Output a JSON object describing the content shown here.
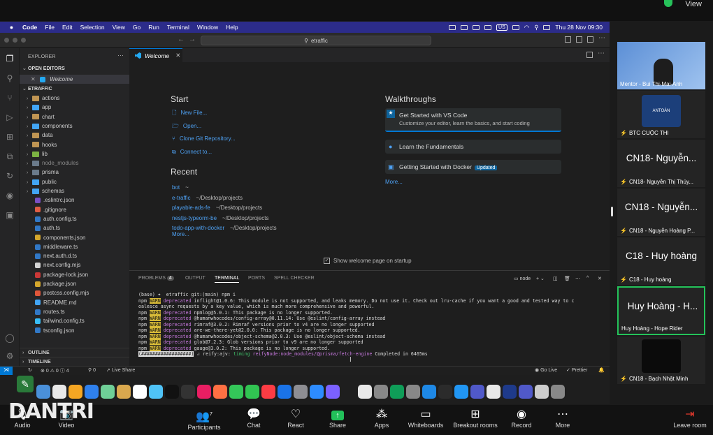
{
  "zoom_top": {
    "view_label": "View"
  },
  "mac_menu": {
    "apple": "",
    "items": [
      "Code",
      "File",
      "Edit",
      "Selection",
      "View",
      "Go",
      "Run",
      "Terminal",
      "Window",
      "Help"
    ],
    "input_source": "US",
    "datetime": "Thu 28 Nov 09:30"
  },
  "vscode": {
    "search_text": "etraffic",
    "explorer_title": "EXPLORER",
    "open_editors_title": "OPEN EDITORS",
    "open_editor_file": "Welcome",
    "project_title": "ETRAFFIC",
    "folders": [
      "actions",
      "app",
      "chart",
      "components",
      "data",
      "hooks",
      "lib",
      "node_modules",
      "prisma",
      "public",
      "schemas"
    ],
    "files": [
      ".eslintrc.json",
      ".gitignore",
      "auth.config.ts",
      "auth.ts",
      "components.json",
      "middleware.ts",
      "next.auth.d.ts",
      "next.config.mjs",
      "package-lock.json",
      "package.json",
      "postcss.config.mjs",
      "README.md",
      "routes.ts",
      "tailwind.config.ts",
      "tsconfig.json"
    ],
    "outline_label": "OUTLINE",
    "timeline_label": "TIMELINE",
    "tab_label": "Welcome",
    "welcome": {
      "start_title": "Start",
      "start_items": [
        "New File...",
        "Open...",
        "Clone Git Repository...",
        "Connect to..."
      ],
      "recent_title": "Recent",
      "recent": [
        {
          "name": "bot",
          "path": "~"
        },
        {
          "name": "e-traffic",
          "path": "~/Desktop/projects"
        },
        {
          "name": "playable-ads-fe",
          "path": "~/Desktop/projects"
        },
        {
          "name": "nestjs-typeorm-be",
          "path": "~/Desktop/projects"
        },
        {
          "name": "todo-app-with-docker",
          "path": "~/Desktop/projects"
        }
      ],
      "recent_more": "More...",
      "walkthroughs_title": "Walkthroughs",
      "walk_items": [
        {
          "title": "Get Started with VS Code",
          "desc": "Customize your editor, learn the basics, and start coding"
        },
        {
          "title": "Learn the Fundamentals"
        },
        {
          "title": "Getting Started with Docker",
          "badge": "Updated"
        }
      ],
      "walk_more": "More...",
      "show_on_startup": "Show welcome page on startup"
    },
    "panel_tabs": [
      "PROBLEMS",
      "OUTPUT",
      "TERMINAL",
      "PORTS",
      "SPELL CHECKER"
    ],
    "problems_count": "4",
    "terminal_shell": "node",
    "terminal": {
      "prompt": "(base) ➜  etraffic git:(main) npm i",
      "lines": [
        {
          "tag": "WARN",
          "kind": "deprecated",
          "text": " inflight@1.0.6: This module is not supported, and leaks memory. Do not use it. Check out lru-cache if you want a good and tested way to c"
        },
        {
          "plain": "oalesce async requests by a key value, which is much more comprehensive and powerful."
        },
        {
          "tag": "WARN",
          "kind": "deprecated",
          "text": " npmlog@5.0.1: This package is no longer supported."
        },
        {
          "tag": "WARN",
          "kind": "deprecated",
          "text": " @humanwhocodes/config-array@0.11.14: Use @eslint/config-array instead"
        },
        {
          "tag": "WARN",
          "kind": "deprecated",
          "text": " rimraf@3.0.2: Rimraf versions prior to v4 are no longer supported"
        },
        {
          "tag": "WARN",
          "kind": "deprecated",
          "text": " are-we-there-yet@2.0.0: This package is no longer supported."
        },
        {
          "tag": "WARN",
          "kind": "deprecated",
          "text": " @humanwhocodes/object-schema@2.0.3: Use @eslint/object-schema instead"
        },
        {
          "tag": "WARN",
          "kind": "deprecated",
          "text": " glob@7.2.3: Glob versions prior to v9 are no longer supported"
        },
        {
          "tag": "WARN",
          "kind": "deprecated",
          "text": " gauge@3.0.2: This package is no longer supported."
        }
      ],
      "progress_bar": "(##################)",
      "progress_text": " ⠴ reify:ajv: ",
      "timing": "timing",
      "reify_node": " reifyNode:node_modules/@prisma/fetch-engine",
      "completed": " Completed in 6465ms"
    },
    "status": {
      "errors": "0",
      "warnings": "0",
      "info": "4",
      "ports": "0",
      "live_share": "Live Share",
      "go_live": "Go Live",
      "prettier": "Prettier"
    }
  },
  "zoom_bar": {
    "audio": "Audio",
    "video": "Video",
    "participants": "Participants",
    "participant_count": "7",
    "chat": "Chat",
    "react": "React",
    "share": "Share",
    "apps": "Apps",
    "whiteboards": "Whiteboards",
    "breakout": "Breakout rooms",
    "record": "Record",
    "more": "More",
    "leave": "Leave room"
  },
  "watermark": "DANTRI",
  "participants": [
    {
      "tile_name": "",
      "label": "Mentor - Bui Thi-Mai-Anh"
    },
    {
      "tile_name": "",
      "label": "BTC CUỘC THI"
    },
    {
      "tile_name": "CN18- Nguyễn...",
      "label": "CN18- Nguyễn Thị Thúy..."
    },
    {
      "tile_name": "CN18 - Nguyễn...",
      "label": "CN18 - Nguyễn Hoàng P..."
    },
    {
      "tile_name": "C18 - Huy hoàng",
      "label": "C18 - Huy hoàng"
    },
    {
      "tile_name": "Huy Hoàng - H...",
      "label": "Huy Hoàng - Hope Rider"
    },
    {
      "tile_name": "",
      "label": "CN18 - Bạch Nhật Minh"
    }
  ],
  "tile_logo_text": "ANTOÀN"
}
